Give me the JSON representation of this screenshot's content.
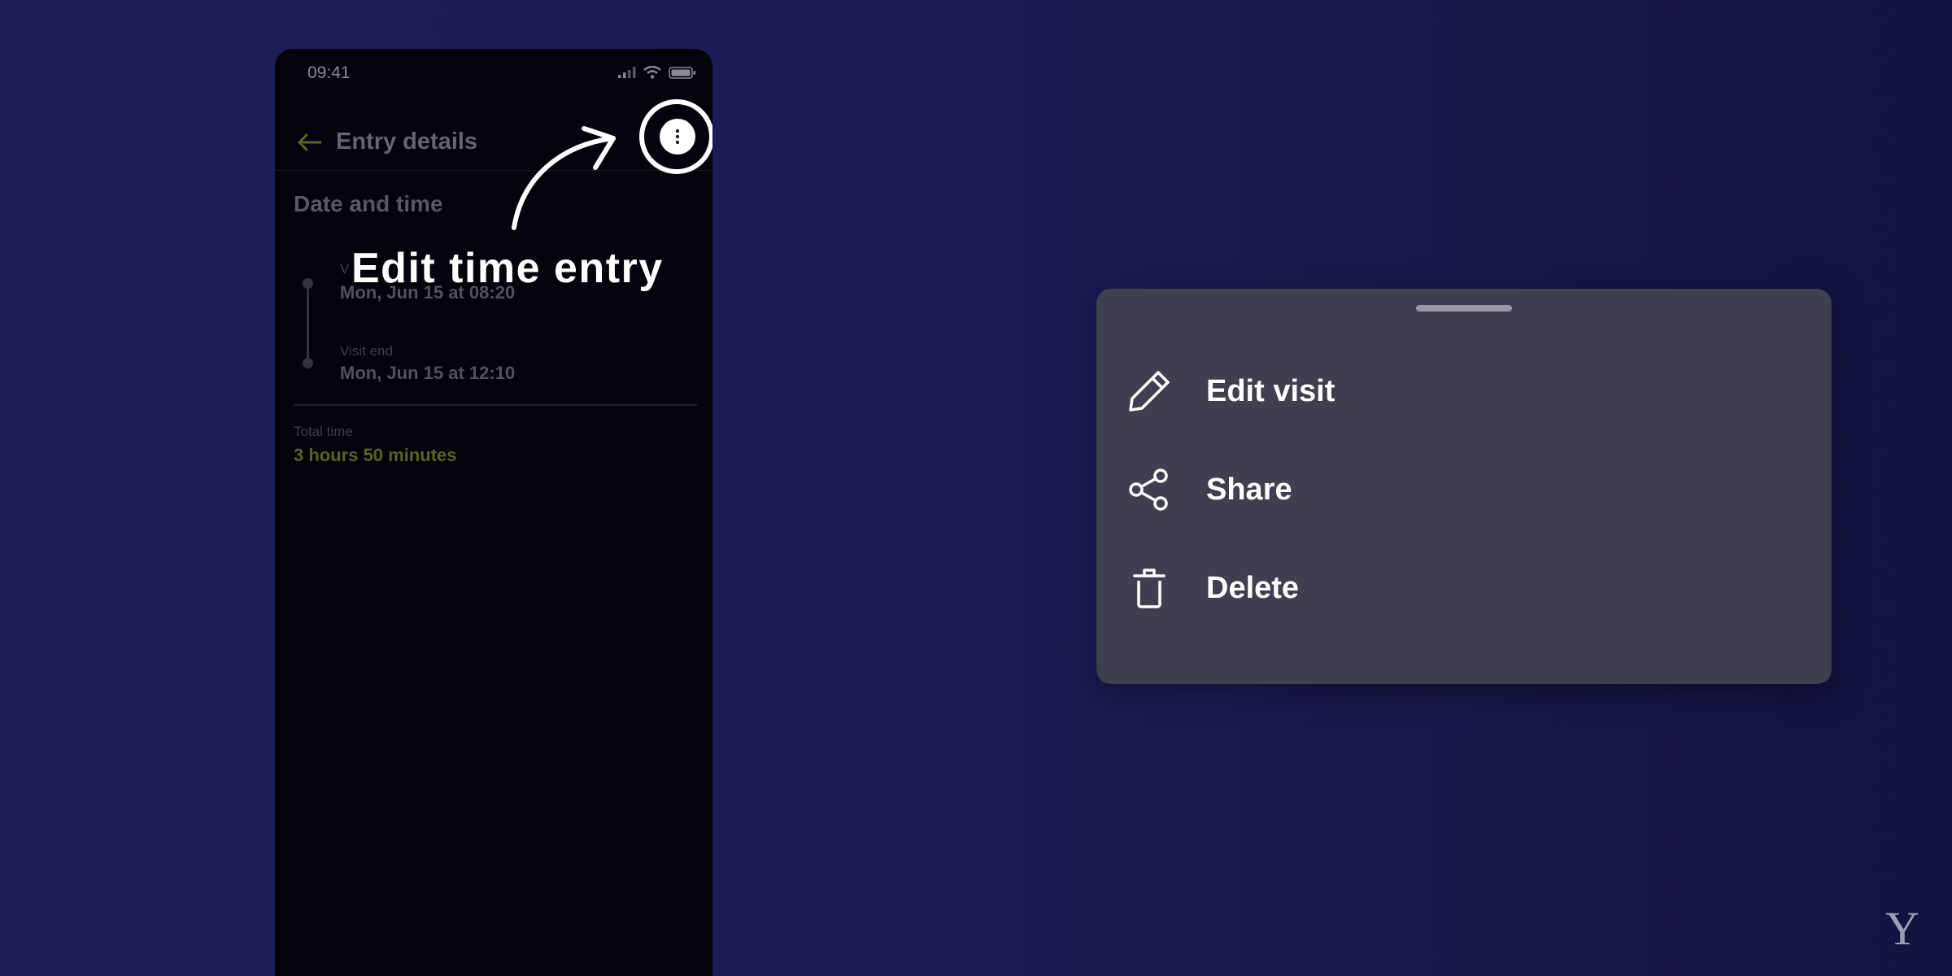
{
  "phone": {
    "status_time": "09:41",
    "header": {
      "title": "Entry details"
    },
    "section_title": "Date and time",
    "visit_start": {
      "label": "V",
      "value": "Mon, Jun 15 at 08:20"
    },
    "visit_end": {
      "label": "Visit end",
      "value": "Mon, Jun 15 at 12:10"
    },
    "total": {
      "label": "Total time",
      "value": "3 hours 50 minutes"
    }
  },
  "annotation": {
    "caption": "Edit time entry"
  },
  "sheet": {
    "items": [
      {
        "label": "Edit visit",
        "icon": "pencil-icon"
      },
      {
        "label": "Share",
        "icon": "share-icon"
      },
      {
        "label": "Delete",
        "icon": "trash-icon"
      }
    ]
  },
  "brand": {
    "logo_text": "Y"
  },
  "colors": {
    "background": "#1c1b55",
    "phone_bg": "#03030b",
    "sheet_bg": "#403f4f",
    "accent_olive": "#5d6220"
  }
}
